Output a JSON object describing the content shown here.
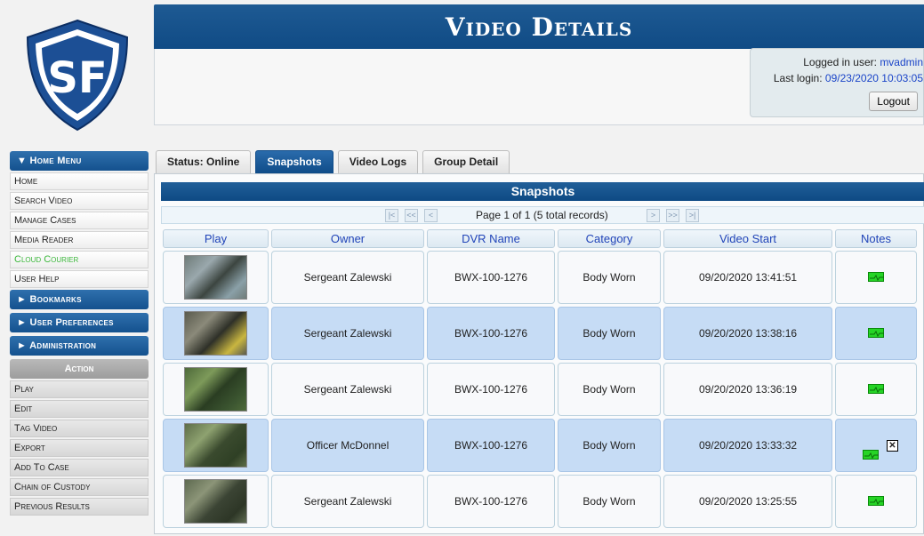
{
  "logo": {
    "text": "SF"
  },
  "header": {
    "title": "Video Details",
    "login_label": "Logged in user:",
    "username": "mvadmin",
    "last_login_label": "Last login:",
    "last_login": "09/23/2020 10:03:05",
    "logout_label": "Logout"
  },
  "sidebar": {
    "home_menu_label": "▼ Home Menu",
    "items": [
      {
        "label": "Home"
      },
      {
        "label": "Search Video"
      },
      {
        "label": "Manage Cases"
      },
      {
        "label": "Media Reader"
      },
      {
        "label": "Cloud Courier"
      },
      {
        "label": "User Help"
      }
    ],
    "bookmarks_label": "► Bookmarks",
    "preferences_label": "► User Preferences",
    "administration_label": "► Administration",
    "action_label": "Action",
    "actions": [
      {
        "label": "Play"
      },
      {
        "label": "Edit"
      },
      {
        "label": "Tag Video"
      },
      {
        "label": "Export"
      },
      {
        "label": "Add To Case"
      },
      {
        "label": "Chain of Custody"
      },
      {
        "label": "Previous Results"
      }
    ]
  },
  "tabs": [
    {
      "label": "Status: Online"
    },
    {
      "label": "Snapshots"
    },
    {
      "label": "Video Logs"
    },
    {
      "label": "Group Detail"
    }
  ],
  "snapshots": {
    "title": "Snapshots",
    "pager": {
      "first": "|<",
      "prev_page": "<<",
      "prev": "<",
      "info": "Page 1 of 1 (5 total records)",
      "next": ">",
      "next_page": ">>",
      "last": ">|"
    },
    "columns": [
      "Play",
      "Owner",
      "DVR Name",
      "Category",
      "Video Start",
      "Notes"
    ],
    "rows": [
      {
        "owner": "Sergeant Zalewski",
        "dvr": "BWX-100-1276",
        "category": "Body Worn",
        "start": "09/20/2020 13:41:51"
      },
      {
        "owner": "Sergeant Zalewski",
        "dvr": "BWX-100-1276",
        "category": "Body Worn",
        "start": "09/20/2020 13:38:16"
      },
      {
        "owner": "Sergeant Zalewski",
        "dvr": "BWX-100-1276",
        "category": "Body Worn",
        "start": "09/20/2020 13:36:19"
      },
      {
        "owner": "Officer McDonnel",
        "dvr": "BWX-100-1276",
        "category": "Body Worn",
        "start": "09/20/2020 13:33:32"
      },
      {
        "owner": "Sergeant Zalewski",
        "dvr": "BWX-100-1276",
        "category": "Body Worn",
        "start": "09/20/2020 13:25:55"
      }
    ]
  },
  "colors": {
    "brand_blue": "#14518e",
    "row_highlight": "#c6dcf5",
    "note_green": "#26d426",
    "link_blue": "#1a44c8"
  }
}
